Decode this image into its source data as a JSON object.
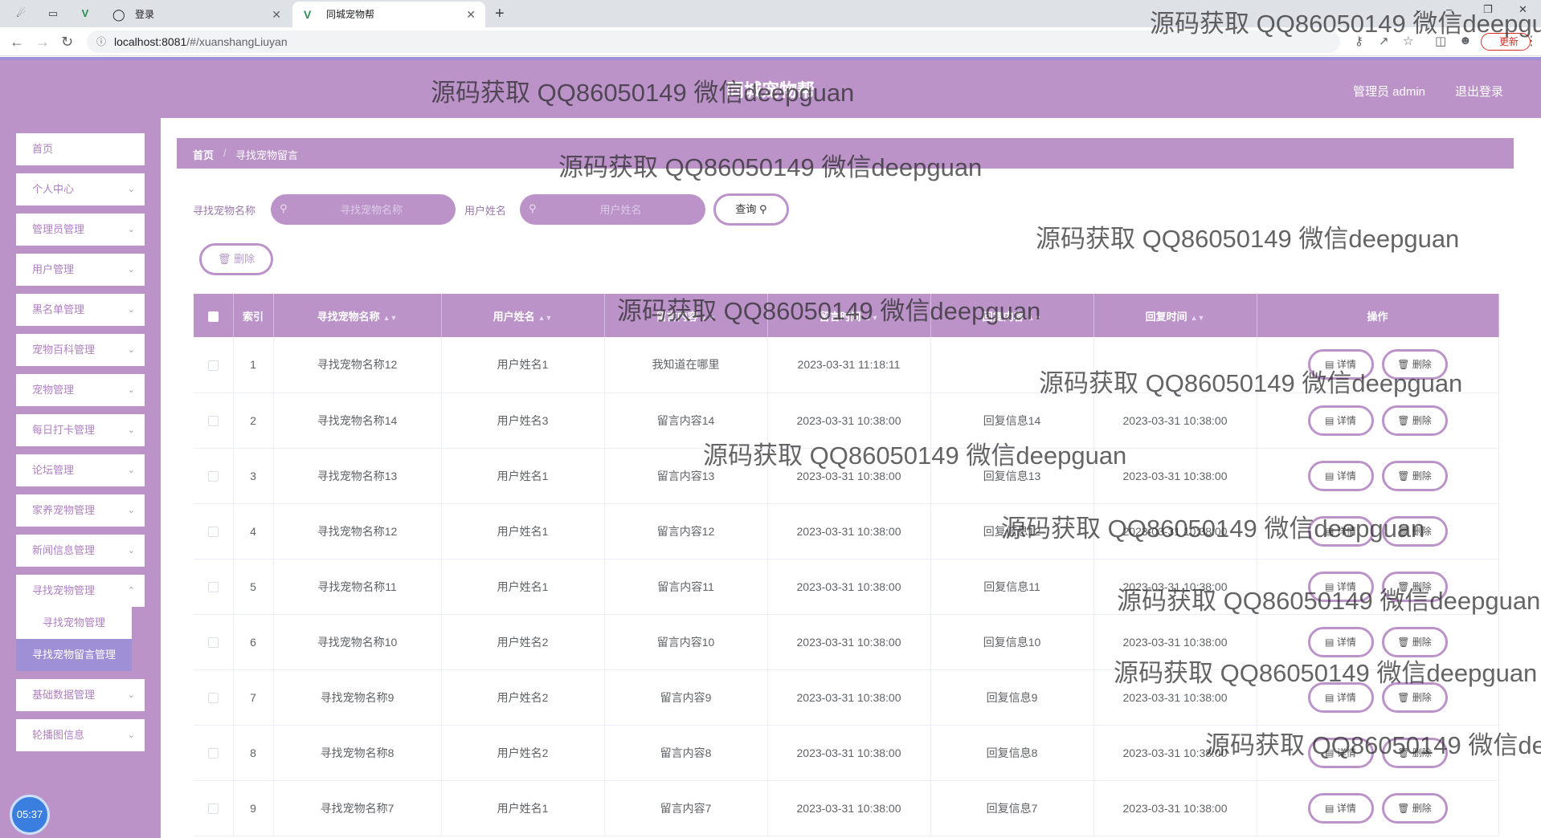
{
  "browser": {
    "tabs": [
      {
        "label": "登录",
        "icon": "globe-icon"
      },
      {
        "label": "同城宠物帮",
        "icon": "vue-icon"
      }
    ],
    "url_prefix": "localhost:8081",
    "url_path": "/#/xuanshangLiuyan",
    "update_label": "更新"
  },
  "header": {
    "title": "同城宠物帮",
    "user": "管理员 admin",
    "logout": "退出登录"
  },
  "sidebar": {
    "items": [
      {
        "label": "首页",
        "expandable": false
      },
      {
        "label": "个人中心",
        "expandable": true
      },
      {
        "label": "管理员管理",
        "expandable": true
      },
      {
        "label": "用户管理",
        "expandable": true
      },
      {
        "label": "黑名单管理",
        "expandable": true
      },
      {
        "label": "宠物百科管理",
        "expandable": true
      },
      {
        "label": "宠物管理",
        "expandable": true
      },
      {
        "label": "每日打卡管理",
        "expandable": true
      },
      {
        "label": "论坛管理",
        "expandable": true
      },
      {
        "label": "家养宠物管理",
        "expandable": true
      },
      {
        "label": "新闻信息管理",
        "expandable": true
      },
      {
        "label": "寻找宠物管理",
        "expandable": true
      }
    ],
    "sub_items": [
      {
        "label": "寻找宠物管理",
        "active": false
      },
      {
        "label": "寻找宠物留言管理",
        "active": true
      }
    ],
    "items_after": [
      {
        "label": "基础数据管理"
      },
      {
        "label": "轮播图信息"
      }
    ],
    "clock": "05:37"
  },
  "breadcrumb": {
    "home": "首页",
    "separator": "/",
    "current": "寻找宠物留言"
  },
  "filters": {
    "pet_name_label": "寻找宠物名称",
    "pet_name_placeholder": "寻找宠物名称",
    "user_name_label": "用户姓名",
    "user_name_placeholder": "用户姓名",
    "query_label": "查询",
    "delete_label": "删除"
  },
  "table": {
    "headers": [
      "索引",
      "寻找宠物名称",
      "用户姓名",
      "留言内容",
      "留言时间",
      "回复内容",
      "回复时间",
      "操作"
    ],
    "detail_label": "详情",
    "delete_label": "删除",
    "rows": [
      {
        "index": "1",
        "pet": "寻找宠物名称12",
        "user": "用户姓名1",
        "content": "我知道在哪里",
        "time": "2023-03-31 11:18:11",
        "reply": "",
        "reply_time": ""
      },
      {
        "index": "2",
        "pet": "寻找宠物名称14",
        "user": "用户姓名3",
        "content": "留言内容14",
        "time": "2023-03-31 10:38:00",
        "reply": "回复信息14",
        "reply_time": "2023-03-31 10:38:00"
      },
      {
        "index": "3",
        "pet": "寻找宠物名称13",
        "user": "用户姓名1",
        "content": "留言内容13",
        "time": "2023-03-31 10:38:00",
        "reply": "回复信息13",
        "reply_time": "2023-03-31 10:38:00"
      },
      {
        "index": "4",
        "pet": "寻找宠物名称12",
        "user": "用户姓名1",
        "content": "留言内容12",
        "time": "2023-03-31 10:38:00",
        "reply": "回复信息12",
        "reply_time": "2023-03-31 10:38:00"
      },
      {
        "index": "5",
        "pet": "寻找宠物名称11",
        "user": "用户姓名1",
        "content": "留言内容11",
        "time": "2023-03-31 10:38:00",
        "reply": "回复信息11",
        "reply_time": "2023-03-31 10:38:00"
      },
      {
        "index": "6",
        "pet": "寻找宠物名称10",
        "user": "用户姓名2",
        "content": "留言内容10",
        "time": "2023-03-31 10:38:00",
        "reply": "回复信息10",
        "reply_time": "2023-03-31 10:38:00"
      },
      {
        "index": "7",
        "pet": "寻找宠物名称9",
        "user": "用户姓名2",
        "content": "留言内容9",
        "time": "2023-03-31 10:38:00",
        "reply": "回复信息9",
        "reply_time": "2023-03-31 10:38:00"
      },
      {
        "index": "8",
        "pet": "寻找宠物名称8",
        "user": "用户姓名2",
        "content": "留言内容8",
        "time": "2023-03-31 10:38:00",
        "reply": "回复信息8",
        "reply_time": "2023-03-31 10:38:00"
      },
      {
        "index": "9",
        "pet": "寻找宠物名称7",
        "user": "用户姓名1",
        "content": "留言内容7",
        "time": "2023-03-31 10:38:00",
        "reply": "回复信息7",
        "reply_time": "2023-03-31 10:38:00"
      }
    ]
  },
  "watermark": "源码获取 QQ86050149 微信deepguan",
  "colors": {
    "accent": "#bb93c9",
    "active": "#9f8fd6"
  }
}
